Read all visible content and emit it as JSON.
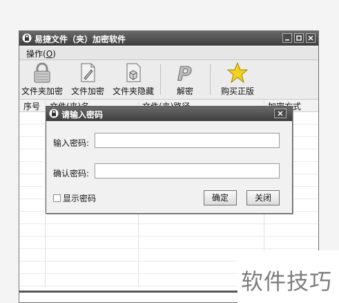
{
  "window": {
    "title": "易捷文件（夹）加密软件"
  },
  "menu": {
    "operate_label": "操作(",
    "operate_key": "O",
    "operate_close": ")"
  },
  "toolbar": [
    {
      "label": "文件夹加密",
      "icon": "padlock-icon"
    },
    {
      "label": "文件加密",
      "icon": "document-pencil-icon"
    },
    {
      "label": "文件夹隐藏",
      "icon": "document-box-icon"
    },
    {
      "label": "解密",
      "icon": "p-logo-icon"
    },
    {
      "label": "购买正版",
      "icon": "star-icon"
    }
  ],
  "list": {
    "columns": [
      "序号",
      "文件(夹)名",
      "文件(夹)路径",
      "加密方式"
    ]
  },
  "dialog": {
    "title": "请输入密码",
    "password_label": "输入密码:",
    "confirm_label": "确认密码:",
    "password_value": "",
    "confirm_value": "",
    "show_password_label": "显示密码",
    "show_password_checked": false,
    "ok_button": "确定",
    "close_button": "关闭"
  },
  "watermark": "软件技巧"
}
